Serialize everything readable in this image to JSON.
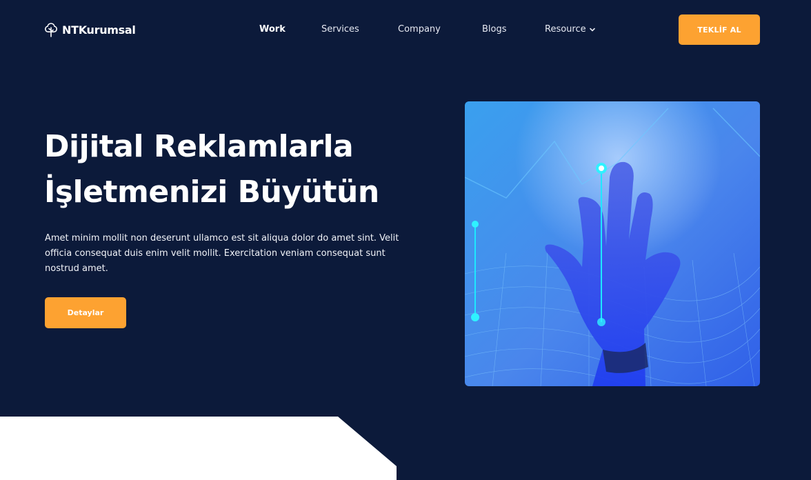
{
  "brand": {
    "name": "NTKurumsal",
    "icon": "tree-icon"
  },
  "nav": {
    "items": [
      {
        "label": "Work",
        "active": true
      },
      {
        "label": "Services",
        "active": false
      },
      {
        "label": "Company",
        "active": false
      },
      {
        "label": "Blogs",
        "active": false
      },
      {
        "label": "Resource",
        "active": false,
        "icon": "chevron-down-icon"
      }
    ],
    "cta_label": "TEKLİF AL"
  },
  "hero": {
    "title_line1": "Dijital Reklamlarla",
    "title_line2": "İşletmenizi Büyütün",
    "description": "Amet minim mollit non deserunt ullamco est sit aliqua dolor do amet sint. Velit officia consequat duis enim velit mollit. Exercitation veniam consequat sunt nostrud amet.",
    "button_label": "Detaylar",
    "image": "digital-hand-touch-image"
  },
  "colors": {
    "background": "#0c1a3a",
    "accent": "#fda231",
    "text": "#ffffff",
    "section_bottom": "#ffffff"
  }
}
